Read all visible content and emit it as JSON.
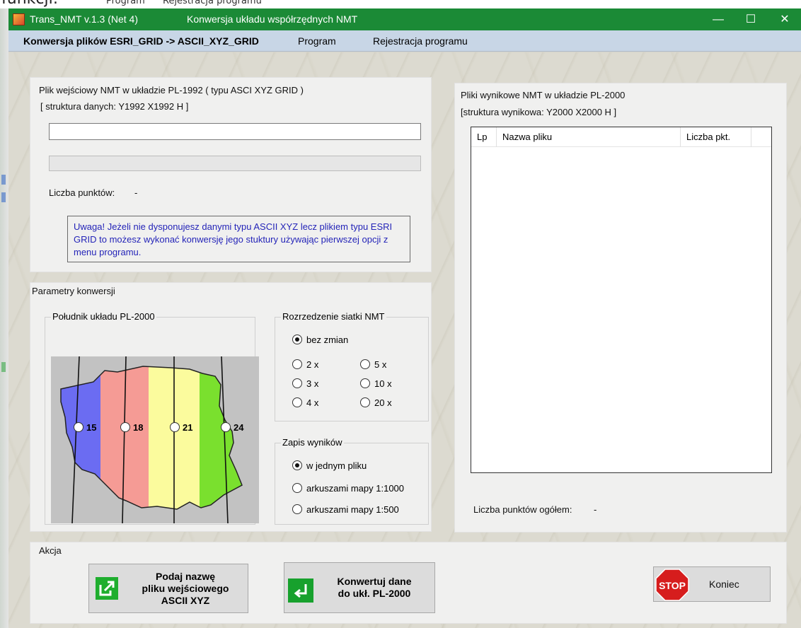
{
  "background": {
    "fragments": [
      "Program",
      "Rejestracja programu"
    ],
    "partial_title": "funkcji:"
  },
  "window": {
    "app_title": "Trans_NMT  v.1.3 (Net 4)",
    "subtitle": "Konwersja układu współrzędnych NMT",
    "titlebar_color": "#1b8a36",
    "controls": {
      "minimize": "—",
      "maximize": "☐",
      "close": "✕"
    }
  },
  "menu": {
    "items": [
      "Konwersja plików ESRI_GRID -> ASCII_XYZ_GRID",
      "Program",
      "Rejestracja programu"
    ]
  },
  "input_panel": {
    "title": "Plik wejściowy NMT w układzie PL-1992    ( typu ASCI XYZ GRID )",
    "structure": "[ struktura danych: Y1992 X1992 H ]",
    "file_value": "",
    "points_label": "Liczba punktów:",
    "points_value": "-",
    "note": "Uwaga! Jeżeli nie dysponujesz danymi typu ASCII XYZ lecz plikiem typu ESRI GRID to możesz wykonać konwersję jego stuktury używając pierwszej opcji z menu programu."
  },
  "results_panel": {
    "title": "Pliki wynikowe NMT w układzie PL-2000",
    "structure": "[struktura wynikowa: Y2000 X2000 H ]",
    "columns": [
      "Lp",
      "Nazwa pliku",
      "Liczba pkt."
    ],
    "rows": [],
    "total_label": "Liczba punktów ogółem:",
    "total_value": "-"
  },
  "params": {
    "title": "Parametry konwersji",
    "meridian": {
      "title": "Południk układu PL-2000",
      "options": [
        "15",
        "18",
        "21",
        "24"
      ],
      "selected": null,
      "zone_colors": [
        "#6b6cf2",
        "#f59b95",
        "#fbfb9d",
        "#7ae02e"
      ]
    },
    "thinning": {
      "title": "Rozrzedzenie siatki NMT",
      "default": "bez zmian",
      "options": [
        "2 x",
        "3 x",
        "4 x",
        "5 x",
        "10 x",
        "20 x"
      ],
      "selected": "bez zmian"
    },
    "output": {
      "title": "Zapis wyników",
      "options": [
        "w jednym pliku",
        "arkuszami mapy 1:1000",
        "arkuszami mapy 1:500"
      ],
      "selected": "w jednym pliku"
    }
  },
  "action": {
    "title": "Akcja",
    "open_button": "Podaj nazwę\npliku wejściowego\nASCII XYZ",
    "convert_button": "Konwertuj dane\ndo ukł. PL-2000",
    "stop_icon_text": "STOP",
    "exit_button": "Koniec"
  }
}
